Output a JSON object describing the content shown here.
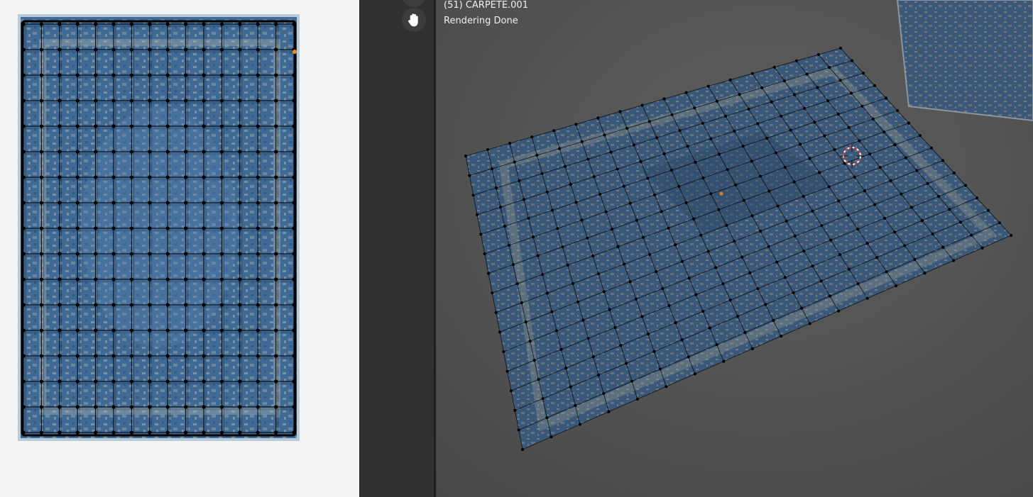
{
  "viewport": {
    "object_info": "(51) CARPETE.001",
    "render_status": "Rendering Done"
  },
  "toolbar": {
    "tools": [
      {
        "name": "tool-above",
        "icon": "tool-icon"
      },
      {
        "name": "pan-view",
        "icon": "hand-icon"
      }
    ]
  },
  "uv_editor": {
    "image": "carpet-texture"
  },
  "colors": {
    "uv_background": "#f4f4f4",
    "toolbar_bg": "#303030",
    "viewport_floor": "#585858",
    "carpet_blue": "#3f6a96",
    "carpet_pattern": "#a8a89a",
    "wire": "#000000",
    "cursor_red": "#d23c3c"
  }
}
